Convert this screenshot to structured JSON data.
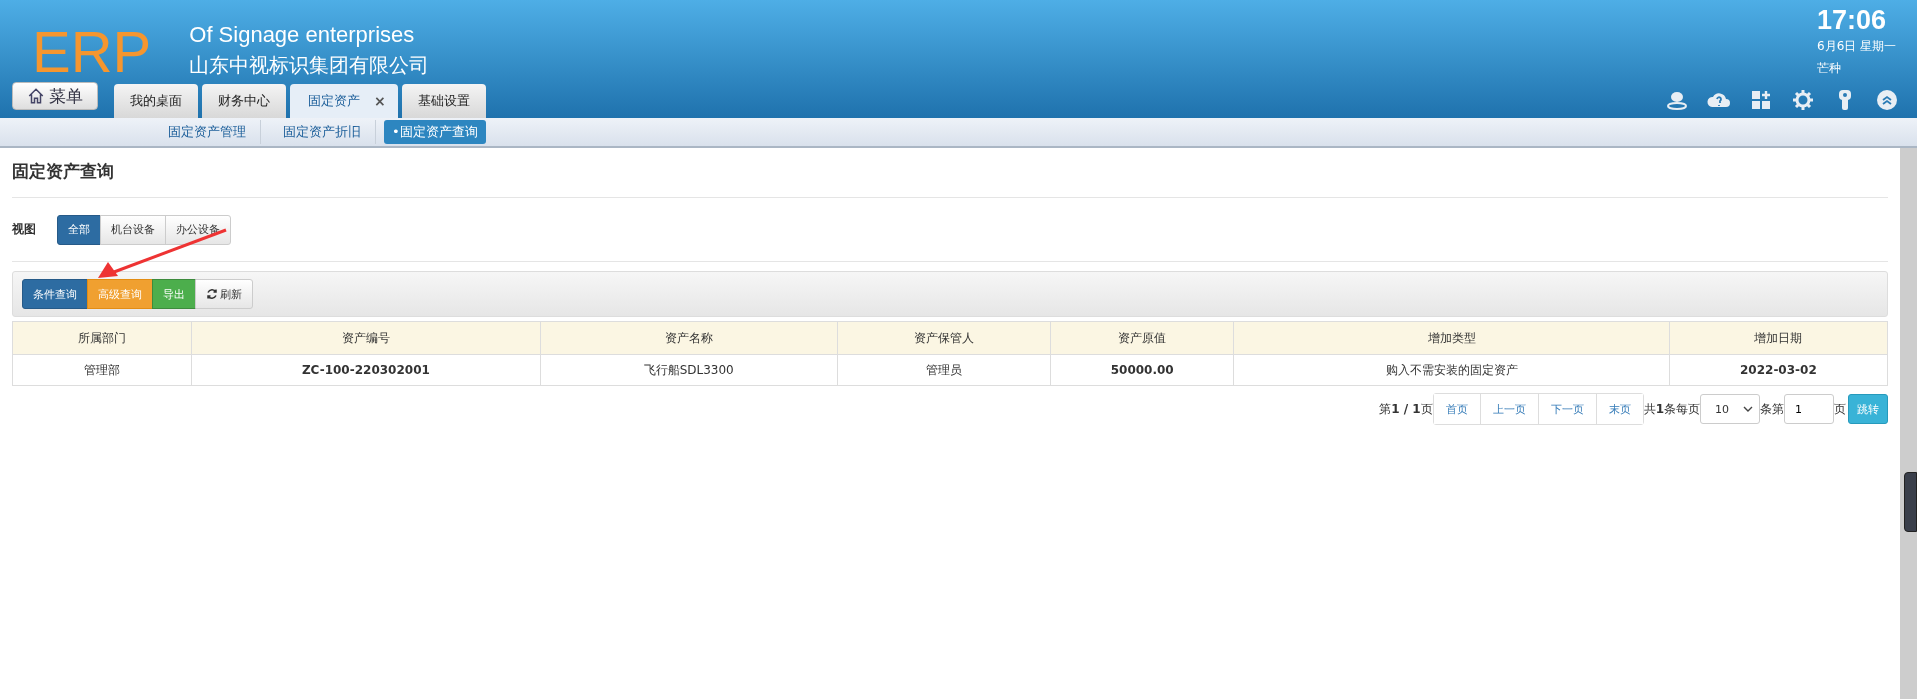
{
  "header": {
    "logo": "ERP",
    "subtitle_en": "Of Signage enterprises",
    "company": "山东中视标识集团有限公司",
    "time": "17:06",
    "date": "6月6日 星期一",
    "solar_term": "芒种"
  },
  "menu_button": {
    "label": "菜单"
  },
  "tabs": [
    {
      "label": "我的桌面",
      "selected": false
    },
    {
      "label": "财务中心",
      "selected": false
    },
    {
      "label": "固定资产",
      "selected": true,
      "close": "×"
    },
    {
      "label": "基础设置",
      "selected": false
    }
  ],
  "subnav": [
    {
      "label": "固定资产管理",
      "selected": false
    },
    {
      "label": "固定资产折旧",
      "selected": false
    },
    {
      "label": "•固定资产查询",
      "selected": true
    }
  ],
  "page_title": "固定资产查询",
  "view": {
    "label": "视图",
    "options": [
      {
        "label": "全部",
        "selected": true
      },
      {
        "label": "机台设备",
        "selected": false
      },
      {
        "label": "办公设备",
        "selected": false
      }
    ]
  },
  "toolbar": [
    {
      "label": "条件查询",
      "kind": "primary"
    },
    {
      "label": "高级查询",
      "kind": "warning"
    },
    {
      "label": "导出",
      "kind": "success"
    },
    {
      "label": "刷新",
      "kind": "refresh"
    }
  ],
  "table": {
    "columns": [
      "所属部门",
      "资产编号",
      "资产名称",
      "资产保管人",
      "资产原值",
      "增加类型",
      "增加日期"
    ],
    "rows": [
      [
        "管理部",
        "ZC-100-220302001",
        "飞行船SDL3300",
        "管理员",
        "50000.00",
        "购入不需安装的固定资产",
        "2022-03-02"
      ]
    ]
  },
  "pagination": {
    "page_info": "第**1 / 1**页",
    "buttons": [
      "首页",
      "上一页",
      "下一页",
      "末页"
    ],
    "total": "共**1**条每页",
    "page_size": "10",
    "goto_prefix": "条第",
    "goto_value": "1",
    "goto_suffix": "页",
    "goto_button": "跳转"
  }
}
